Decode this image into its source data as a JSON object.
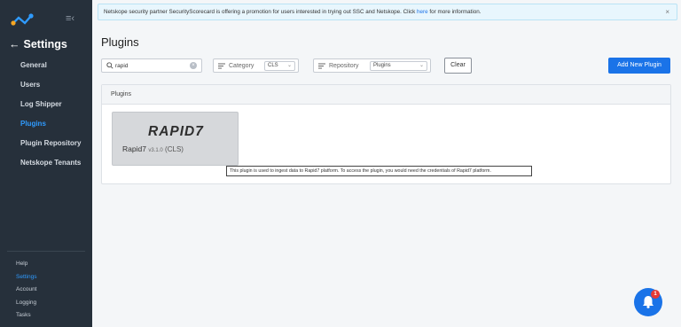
{
  "sidebar": {
    "back_label": "Settings",
    "nav": [
      "General",
      "Users",
      "Log Shipper",
      "Plugins",
      "Plugin Repository",
      "Netskope Tenants"
    ],
    "active_nav": "Plugins",
    "bottom": [
      "Help",
      "Settings",
      "Account",
      "Logging",
      "Tasks"
    ],
    "active_bottom": "Settings"
  },
  "banner": {
    "text_before": "Netskope security partner SecurityScorecard is offering a promotion for users interested in trying out SSC and Netskope. Click ",
    "link": "here",
    "text_after": " for more information.",
    "close": "×"
  },
  "page": {
    "title": "Plugins"
  },
  "search": {
    "value": "rapid"
  },
  "filters": {
    "category": {
      "label": "Category",
      "value": "CLS"
    },
    "repository": {
      "label": "Repository",
      "value": "Plugins"
    }
  },
  "buttons": {
    "clear": "Clear",
    "add": "Add New Plugin"
  },
  "panel": {
    "title": "Plugins"
  },
  "card": {
    "logo_text": "RAPID7",
    "name": "Rapid7",
    "version": "v3.1.0",
    "tag": "(CLS)"
  },
  "tooltip": "This plugin is used to ingest data to Rapid7 platform. To access the plugin, you would need the credentials of Rapid7 platform.",
  "notification": {
    "count": "1"
  },
  "colors": {
    "accent": "#1a73e8",
    "sidebar": "#26303b",
    "active": "#2f9bff",
    "badge": "#e53935"
  }
}
